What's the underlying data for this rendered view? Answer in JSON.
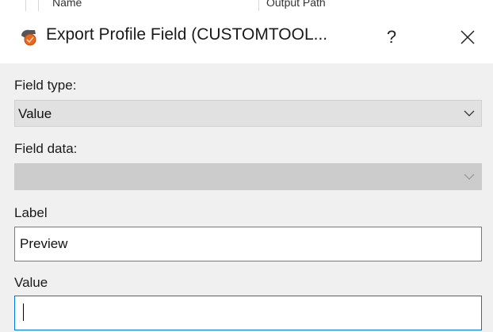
{
  "background_window": {
    "col_name": "Name",
    "col_output": "Output Path"
  },
  "dialog": {
    "title": "Export Profile Field (CUSTOMTOOL...",
    "help_label": "?",
    "icon": "app-tool-icon",
    "close_icon": "close-icon"
  },
  "form": {
    "field_type_label": "Field type:",
    "field_type_value": "Value",
    "field_data_label": "Field data:",
    "field_data_value": "",
    "label_label": "Label",
    "label_value": "Preview",
    "value_label": "Value",
    "value_value": ""
  },
  "colors": {
    "focus_border": "#0078d7",
    "dialog_bg": "#f0f0f0",
    "combo_bg": "#e1e1e1",
    "icon_orange": "#e8691f"
  }
}
